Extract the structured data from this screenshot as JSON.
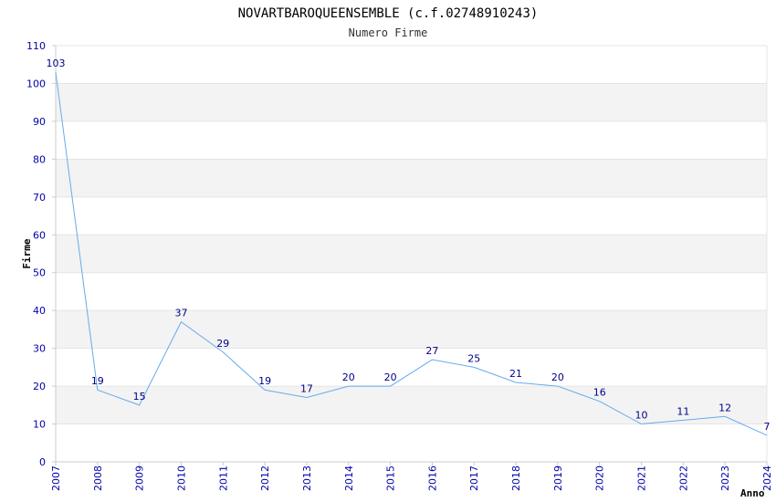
{
  "chart_data": {
    "type": "line",
    "title": "NOVARTBAROQUEENSEMBLE (c.f.02748910243)",
    "subtitle": "Numero Firme",
    "xlabel": "Anno",
    "ylabel": "Firme",
    "x": [
      "2007",
      "2008",
      "2009",
      "2010",
      "2011",
      "2012",
      "2013",
      "2014",
      "2015",
      "2016",
      "2017",
      "2018",
      "2019",
      "2020",
      "2021",
      "2022",
      "2023",
      "2024"
    ],
    "values": [
      103,
      19,
      15,
      37,
      29,
      19,
      17,
      20,
      20,
      27,
      25,
      21,
      20,
      16,
      10,
      11,
      12,
      7
    ],
    "ylim": [
      0,
      110
    ],
    "yticks": [
      0,
      10,
      20,
      30,
      40,
      50,
      60,
      70,
      80,
      90,
      100,
      110
    ],
    "grid": "horizontal alternating bands",
    "colors": {
      "line": "#66aaee",
      "band": "#f3f3f3",
      "axis": "#cccccc",
      "tick_text": "#0000aa"
    }
  }
}
